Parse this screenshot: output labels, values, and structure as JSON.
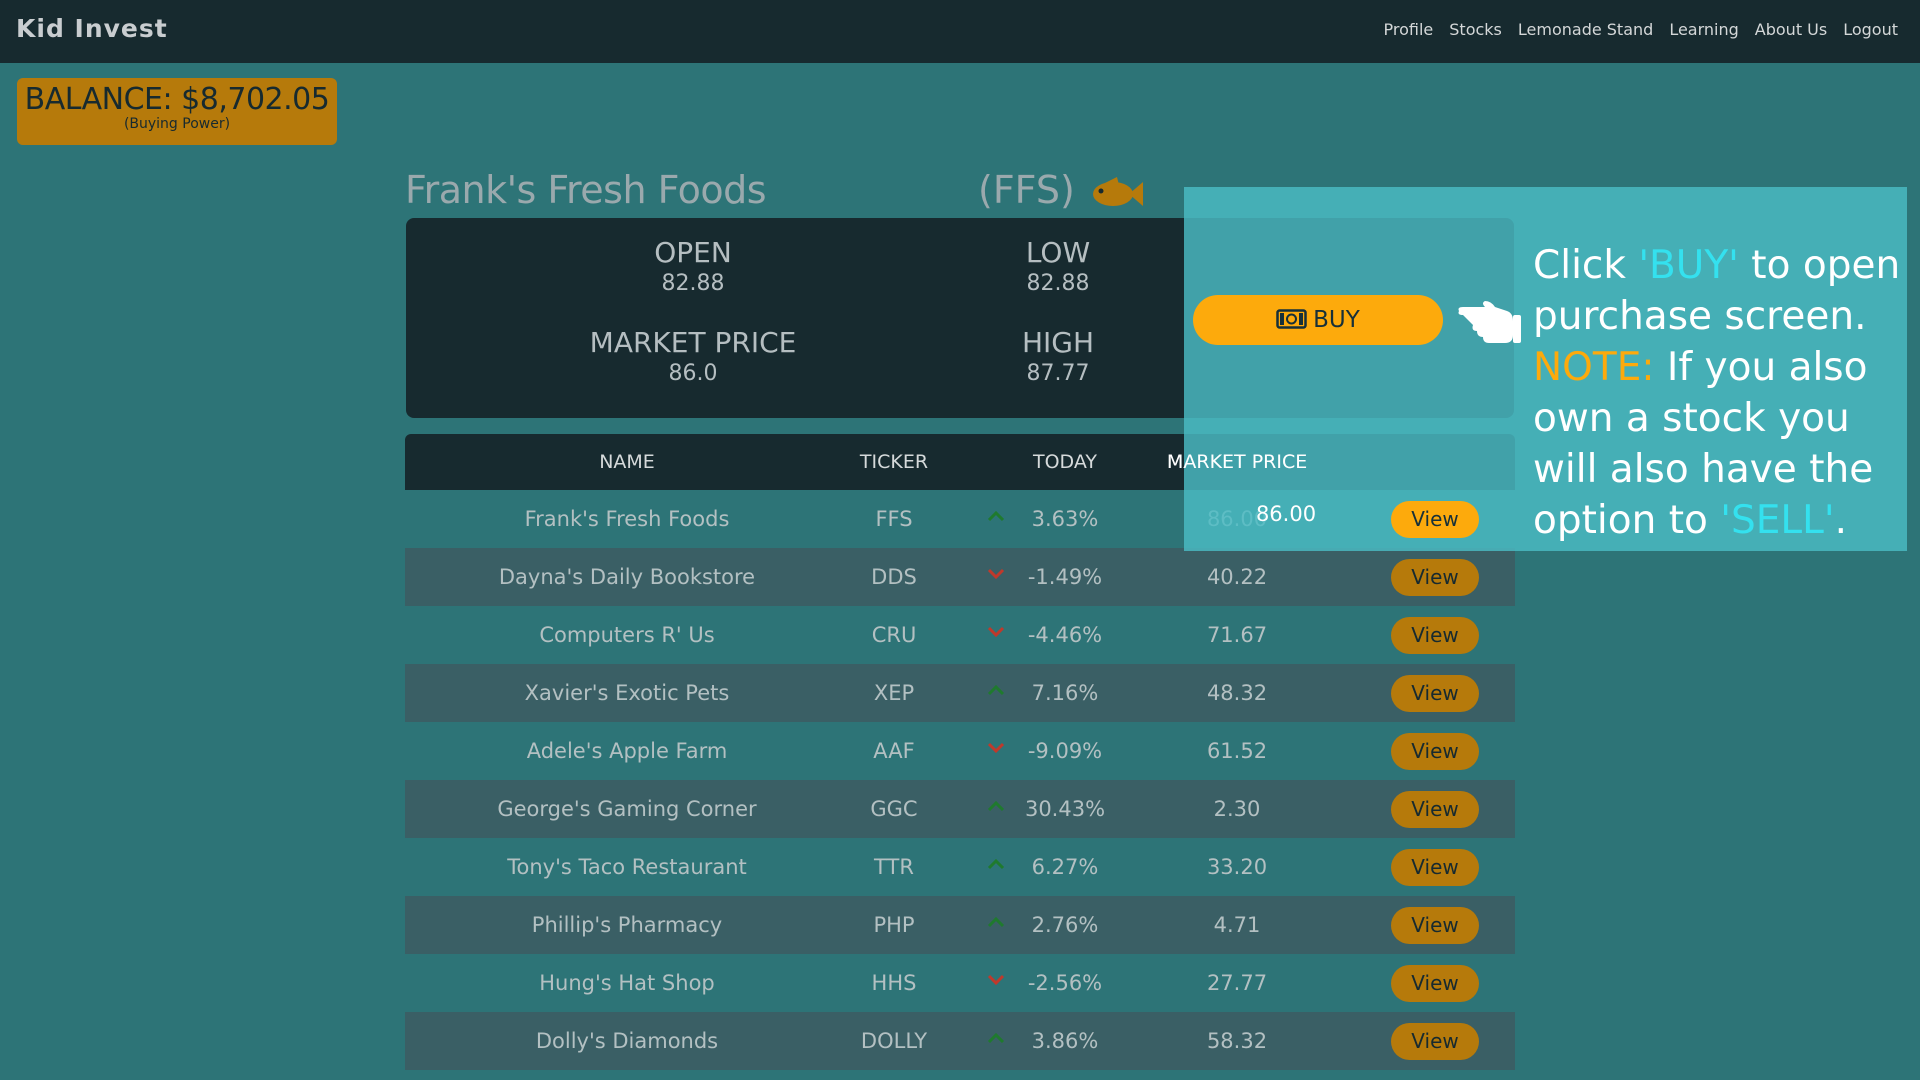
{
  "nav": {
    "logo": "Kid Invest",
    "links": [
      "Profile",
      "Stocks",
      "Lemonade Stand",
      "Learning",
      "About Us",
      "Logout"
    ]
  },
  "balance": {
    "main": "BALANCE: $8,702.05",
    "sub": "(Buying Power)"
  },
  "stock": {
    "name": "Frank's Fresh Foods",
    "ticker": "(FFS)",
    "icon": "fish-icon",
    "open_label": "OPEN",
    "open_value": "82.88",
    "low_label": "LOW",
    "low_value": "82.88",
    "market_label": "MARKET PRICE",
    "market_value": "86.0",
    "high_label": "HIGH",
    "high_value": "87.77",
    "buy_label": "BUY"
  },
  "table": {
    "headers": {
      "name": "NAME",
      "ticker": "TICKER",
      "today": "TODAY",
      "market_price": "MARKET PRICE"
    },
    "view_label": "View",
    "rows": [
      {
        "name": "Frank's Fresh Foods",
        "ticker": "FFS",
        "direction": "up",
        "today": "3.63%",
        "price": "86.00"
      },
      {
        "name": "Dayna's Daily Bookstore",
        "ticker": "DDS",
        "direction": "down",
        "today": "-1.49%",
        "price": "40.22"
      },
      {
        "name": "Computers R' Us",
        "ticker": "CRU",
        "direction": "down",
        "today": "-4.46%",
        "price": "71.67"
      },
      {
        "name": "Xavier's Exotic Pets",
        "ticker": "XEP",
        "direction": "up",
        "today": "7.16%",
        "price": "48.32"
      },
      {
        "name": "Adele's Apple Farm",
        "ticker": "AAF",
        "direction": "down",
        "today": "-9.09%",
        "price": "61.52"
      },
      {
        "name": "George's Gaming Corner",
        "ticker": "GGC",
        "direction": "up",
        "today": "30.43%",
        "price": "2.30"
      },
      {
        "name": "Tony's Taco Restaurant",
        "ticker": "TTR",
        "direction": "up",
        "today": "6.27%",
        "price": "33.20"
      },
      {
        "name": "Phillip's Pharmacy",
        "ticker": "PHP",
        "direction": "up",
        "today": "2.76%",
        "price": "4.71"
      },
      {
        "name": "Hung's Hat Shop",
        "ticker": "HHS",
        "direction": "down",
        "today": "-2.56%",
        "price": "27.77"
      },
      {
        "name": "Dolly's Diamonds",
        "ticker": "DOLLY",
        "direction": "up",
        "today": "3.86%",
        "price": "58.32"
      }
    ]
  },
  "tutorial": {
    "part1": "Click ",
    "buy_word": "'BUY'",
    "part2": " to open purchase screen.",
    "note_word": "NOTE:",
    "part3": " If you also own a stock you will also have the option to ",
    "sell_word": "'SELL'",
    "part4": "."
  },
  "colors": {
    "background": "#2d7477",
    "navbar": "#172a2f",
    "accent": "#fdaa0c",
    "accent_dim": "#b67a0b",
    "up": "#1f7a2e",
    "down": "#c0392b",
    "tutorial_highlight": "#34e1ef"
  }
}
